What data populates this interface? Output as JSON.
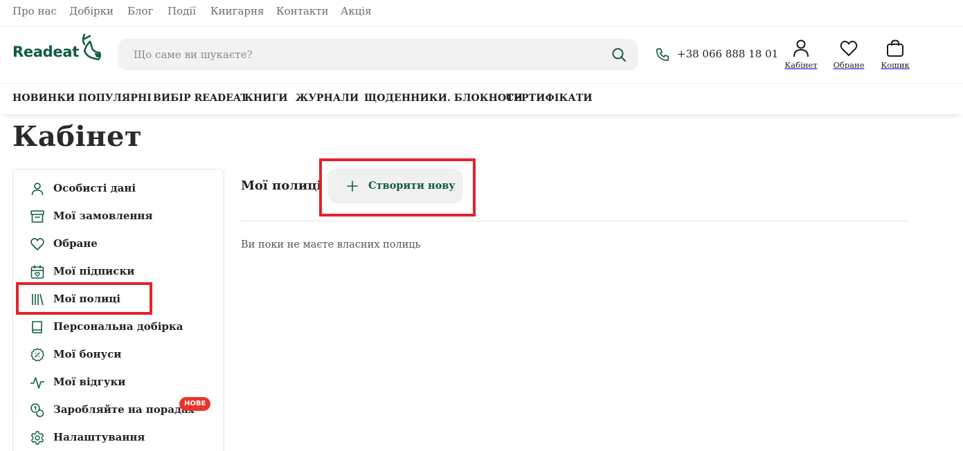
{
  "top_links": [
    "Про нас",
    "Добірки",
    "Блог",
    "Події",
    "Книгарня",
    "Контакти",
    "Акція"
  ],
  "brand": {
    "name": "Readeat",
    "color": "#0f5c43"
  },
  "search": {
    "placeholder": "Що саме ви шукаєте?",
    "value": ""
  },
  "phone": "+38 066 888 18 01",
  "header_icons": {
    "cabinet": "Кабінет",
    "favorites": "Обране",
    "cart": "Кошик"
  },
  "categories": [
    "НОВИНКИ",
    "ПОПУЛЯРНІ",
    "ВИБІР READEAT",
    "КНИГИ",
    "ЖУРНАЛИ",
    "ЩОДЕННИКИ. БЛОКНОТИ",
    "СЕРТИФІКАТИ"
  ],
  "page_title": "Кабінет",
  "sidebar": {
    "items": [
      {
        "label": "Особисті дані",
        "icon": "user-icon"
      },
      {
        "label": "Мої замовлення",
        "icon": "archive-box-icon"
      },
      {
        "label": "Обране",
        "icon": "heart-icon"
      },
      {
        "label": "Мої підписки",
        "icon": "calendar-heart-icon"
      },
      {
        "label": "Мої полиці",
        "icon": "bookshelf-icon"
      },
      {
        "label": "Персональна добірка",
        "icon": "book-icon"
      },
      {
        "label": "Мої бонуси",
        "icon": "percent-badge-icon"
      },
      {
        "label": "Мої відгуки",
        "icon": "activity-icon"
      },
      {
        "label": "Заробляйте на порадах",
        "icon": "coins-icon",
        "badge": "НОВЕ"
      },
      {
        "label": "Налаштування",
        "icon": "gear-icon"
      }
    ]
  },
  "main": {
    "shelves_title": "Мої полиці",
    "create_button": "Створити нову",
    "empty_message": "Ви поки не маєте власних полиць"
  },
  "colors": {
    "accent": "#0f5c43",
    "highlight": "#e3212b",
    "badge": "#e8362b"
  }
}
